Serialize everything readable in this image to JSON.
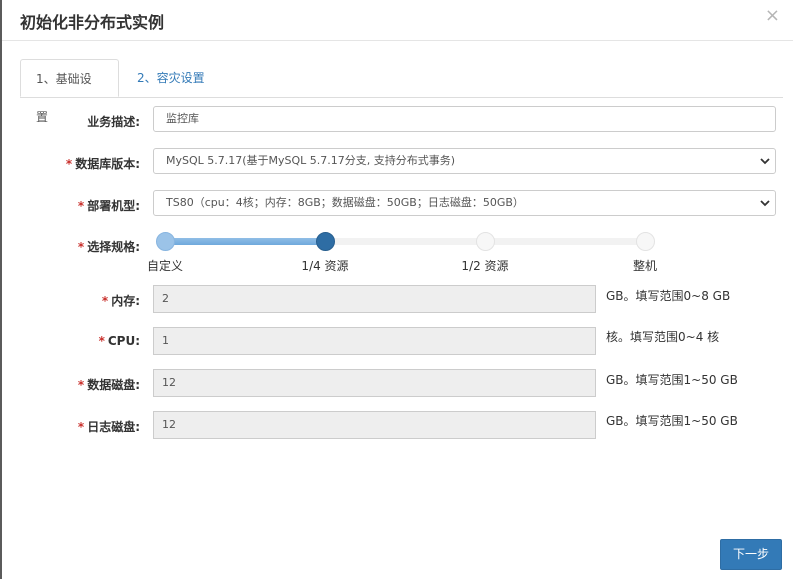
{
  "dialog": {
    "title": "初始化非分布式实例",
    "close_glyph": "×"
  },
  "tabs": [
    {
      "label": "1、基础设置",
      "active": true
    },
    {
      "label": "2、容灾设置",
      "active": false
    }
  ],
  "form": {
    "required_mark": "*",
    "business_desc": {
      "label": "业务描述:",
      "value": "监控库"
    },
    "db_version": {
      "label": "数据库版本:",
      "selected": "MySQL 5.7.17(基于MySQL 5.7.17分支, 支持分布式事务)"
    },
    "deploy_model": {
      "label": "部署机型:",
      "selected": "TS80（cpu：4核；内存：8GB；数据磁盘：50GB；日志磁盘：50GB）"
    },
    "spec": {
      "label": "选择规格:",
      "options": [
        "自定义",
        "1/4 资源",
        "1/2 资源",
        "整机"
      ],
      "selected_index": 1
    },
    "memory": {
      "label": "内存:",
      "value": "2",
      "hint": "GB。填写范围0~8 GB"
    },
    "cpu": {
      "label": "CPU:",
      "value": "1",
      "hint": "核。填写范围0~4 核"
    },
    "data_disk": {
      "label": "数据磁盘:",
      "value": "12",
      "hint": "GB。填写范围1~50 GB"
    },
    "log_disk": {
      "label": "日志磁盘:",
      "value": "12",
      "hint": "GB。填写范围1~50 GB"
    }
  },
  "footer": {
    "next_label": "下一步"
  },
  "colors": {
    "primary": "#337ab7",
    "required": "#c9302c",
    "slider_fill": "#7fb2e0",
    "slider_knob_active": "#2e6da4"
  }
}
